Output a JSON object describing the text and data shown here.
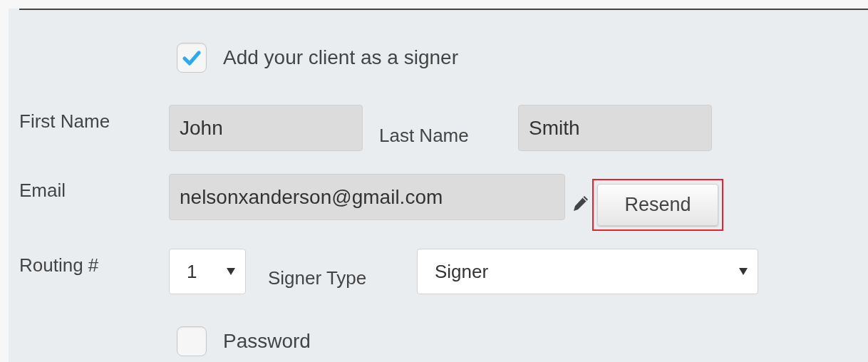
{
  "signer_checkbox": {
    "label": "Add your client as a signer",
    "checked": true
  },
  "fields": [
    {
      "label": "First Name",
      "value": "John"
    },
    {
      "label": "Last Name",
      "value": "Smith"
    },
    {
      "label": "Email",
      "value": "nelsonxanderson@gmail.com"
    }
  ],
  "resend_button": {
    "label": "Resend",
    "highlighted": true
  },
  "routing": {
    "label": "Routing #",
    "value": "1"
  },
  "signer_type": {
    "label": "Signer Type",
    "value": "Signer"
  },
  "password_checkbox": {
    "label": "Password",
    "checked": false
  }
}
